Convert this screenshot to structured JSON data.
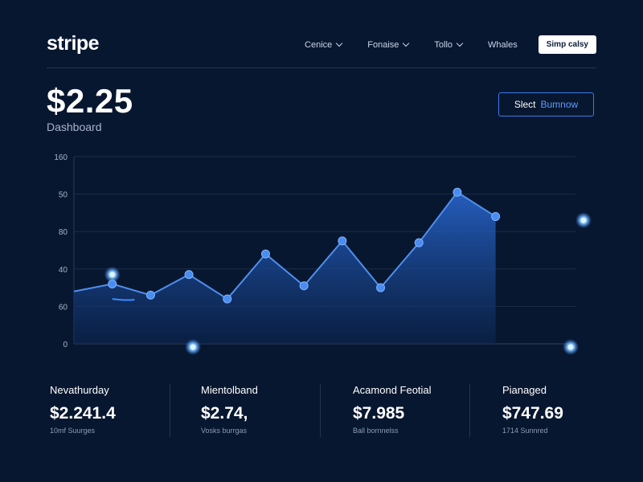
{
  "header": {
    "logo": "stripe",
    "nav": [
      {
        "label": "Cenice",
        "has_dropdown": true
      },
      {
        "label": "Fonaise",
        "has_dropdown": true
      },
      {
        "label": "Tollo",
        "has_dropdown": true
      },
      {
        "label": "Whales",
        "has_dropdown": false
      }
    ],
    "cta_label": "Simp calsy"
  },
  "summary": {
    "balance": "$2.25",
    "subtitle": "Dashboard",
    "select_label_a": "Slect",
    "select_label_b": "Bumnow"
  },
  "chart_data": {
    "type": "area",
    "title": "",
    "xlabel": "",
    "ylabel": "",
    "y_tick_labels": [
      "0",
      "60",
      "40",
      "80",
      "50",
      "160"
    ],
    "ylim": [
      0,
      5
    ],
    "grid": true,
    "x": [
      1,
      2,
      3,
      4,
      5,
      6,
      7,
      8,
      9,
      10,
      11,
      12,
      13,
      14
    ],
    "series": [
      {
        "values": [
          1.4,
          1.6,
          1.3,
          1.85,
          1.2,
          2.4,
          1.55,
          2.75,
          1.5,
          2.7,
          4.05,
          3.4
        ]
      }
    ],
    "accent_color": "#3a7bea"
  },
  "stats": [
    {
      "title": "Nevathurday",
      "value": "$2.241.4",
      "sub": "10mf Suurges"
    },
    {
      "title": "Mientolband",
      "value": "$2.74,",
      "sub": "Vosks burrgas"
    },
    {
      "title": "Acamond Feotial",
      "value": "$7.985",
      "sub": "Ball bornnelss"
    },
    {
      "title": "Pianaged",
      "value": "$747.69",
      "sub": "1714 Sunnred"
    }
  ]
}
